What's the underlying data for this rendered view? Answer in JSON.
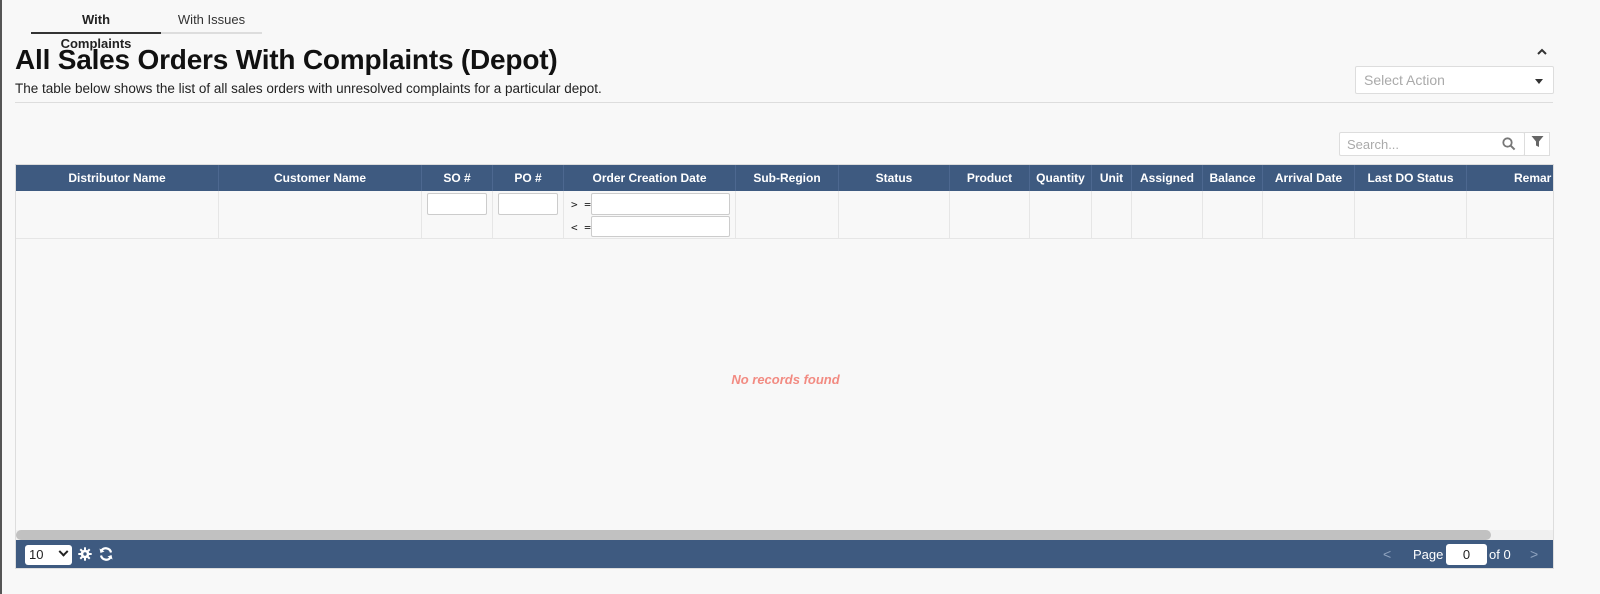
{
  "tabs": [
    {
      "label": "With Complaints",
      "active": true
    },
    {
      "label": "With Issues",
      "active": false
    }
  ],
  "header": {
    "title": "All Sales Orders With Complaints (Depot)",
    "subtitle": "The table below shows the list of all sales orders with unresolved complaints for a particular depot."
  },
  "actions": {
    "select_action_placeholder": "Select Action"
  },
  "search": {
    "placeholder": "Search..."
  },
  "grid": {
    "columns": [
      "Distributor Name",
      "Customer Name",
      "SO #",
      "PO #",
      "Order Creation Date",
      "Sub-Region",
      "Status",
      "Product",
      "Quantity",
      "Unit",
      "Assigned",
      "Balance",
      "Arrival Date",
      "Last DO Status",
      "Remar"
    ],
    "date_filter": {
      "gte_label": "> =",
      "lte_label": "< ="
    },
    "empty_message": "No records found"
  },
  "pager": {
    "page_size": "10",
    "page_label": "Page",
    "current_page": "0",
    "of_label": "of 0",
    "prev": "<",
    "next": ">"
  },
  "colors": {
    "header_bg": "#3e5a80",
    "empty_text": "#f28b82"
  }
}
